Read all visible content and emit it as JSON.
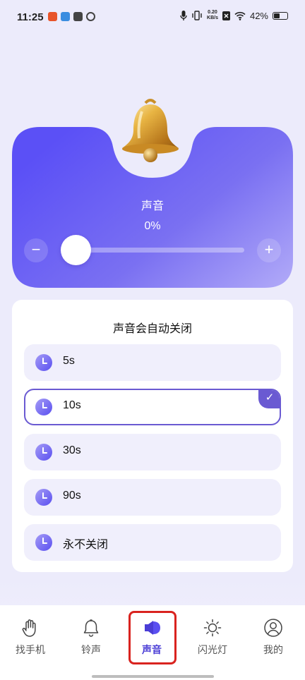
{
  "status_bar": {
    "time": "11:25",
    "speed_value": "0.20",
    "speed_unit": "KB/s",
    "battery": "42%"
  },
  "sound": {
    "title": "声音",
    "volume": "0%",
    "volume_fraction": 0
  },
  "auto_off": {
    "title": "声音会自动关闭",
    "options": [
      {
        "label": "5s",
        "selected": false
      },
      {
        "label": "10s",
        "selected": true
      },
      {
        "label": "30s",
        "selected": false
      },
      {
        "label": "90s",
        "selected": false
      },
      {
        "label": "永不关闭",
        "selected": false
      }
    ]
  },
  "nav": {
    "items": [
      {
        "label": "找手机",
        "icon": "hand-icon",
        "active": false
      },
      {
        "label": "铃声",
        "icon": "bell-icon",
        "active": false
      },
      {
        "label": "声音",
        "icon": "speaker-icon",
        "active": true
      },
      {
        "label": "闪光灯",
        "icon": "sun-icon",
        "active": false
      },
      {
        "label": "我的",
        "icon": "profile-icon",
        "active": false
      }
    ]
  },
  "colors": {
    "accent": "#5a4ff0",
    "accent_light": "#a59cf6",
    "highlight": "#d9231f",
    "background": "#ecebfb"
  }
}
